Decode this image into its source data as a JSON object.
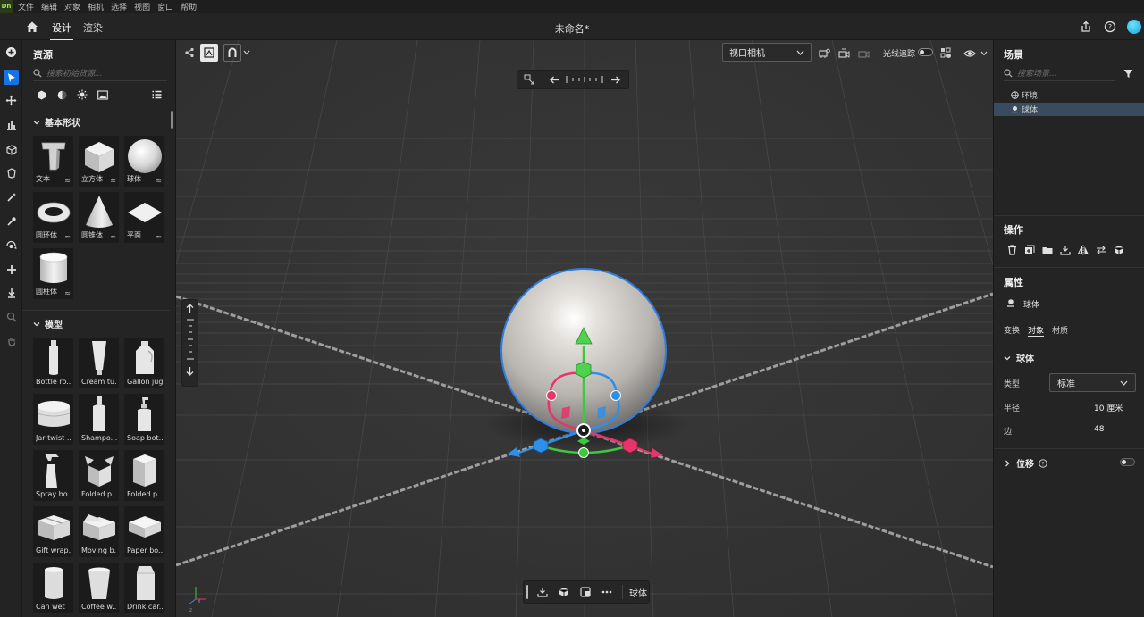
{
  "app": {
    "logo": "Dn",
    "document_title": "未命名*"
  },
  "menu": [
    "文件",
    "编辑",
    "对象",
    "相机",
    "选择",
    "视图",
    "窗口",
    "帮助"
  ],
  "mode_tabs": [
    {
      "label": "设计",
      "active": true
    },
    {
      "label": "渲染",
      "active": false
    }
  ],
  "assets_panel": {
    "title": "资源",
    "search_placeholder": "搜索初始货源...",
    "basic_shapes": {
      "title": "基本形状",
      "items": [
        {
          "label": "文本",
          "icon": "text-t-icon"
        },
        {
          "label": "立方体",
          "icon": "cube-icon"
        },
        {
          "label": "球体",
          "icon": "sphere-icon"
        },
        {
          "label": "圆环体",
          "icon": "torus-icon"
        },
        {
          "label": "圆锥体",
          "icon": "cone-icon"
        },
        {
          "label": "平面",
          "icon": "plane-icon"
        },
        {
          "label": "圆柱体",
          "icon": "cylinder-icon"
        }
      ]
    },
    "models": {
      "title": "模型",
      "items": [
        {
          "label": "Bottle ro...",
          "icon": "bottle-icon"
        },
        {
          "label": "Cream tu...",
          "icon": "tube-icon"
        },
        {
          "label": "Gallon jug",
          "icon": "jug-icon"
        },
        {
          "label": "Jar twist ...",
          "icon": "jar-icon"
        },
        {
          "label": "Shampo...",
          "icon": "shampoo-icon"
        },
        {
          "label": "Soap bot...",
          "icon": "soap-bottle-icon"
        },
        {
          "label": "Spray bo...",
          "icon": "spray-bottle-icon"
        },
        {
          "label": "Folded p...",
          "icon": "open-box-icon"
        },
        {
          "label": "Folded p...",
          "icon": "box-icon"
        },
        {
          "label": "Gift wrap...",
          "icon": "gift-box-icon"
        },
        {
          "label": "Moving b...",
          "icon": "moving-box-icon"
        },
        {
          "label": "Paper bo...",
          "icon": "paper-box-icon"
        },
        {
          "label": "Can wet",
          "icon": "can-icon"
        },
        {
          "label": "Coffee w...",
          "icon": "coffee-cup-icon"
        },
        {
          "label": "Drink car...",
          "icon": "carton-icon"
        }
      ]
    }
  },
  "viewport": {
    "camera_select": "视口相机",
    "light_tracing_label": "光线追踪",
    "light_tracing_on": false,
    "selected_object_label": "球体"
  },
  "scene_panel": {
    "title": "场景",
    "search_placeholder": "搜索场景...",
    "items": [
      {
        "label": "环境",
        "selected": false,
        "icon": "globe-icon"
      },
      {
        "label": "球体",
        "selected": true,
        "icon": "shape-icon"
      }
    ]
  },
  "actions_panel": {
    "title": "操作"
  },
  "properties_panel": {
    "title": "属性",
    "object_name": "球体",
    "tabs": [
      {
        "label": "变换",
        "active": false
      },
      {
        "label": "对象",
        "active": true
      },
      {
        "label": "材质",
        "active": false
      }
    ],
    "section_title": "球体",
    "type_label": "类型",
    "type_value": "标准",
    "radius_label": "半径",
    "radius_value": "10 厘米",
    "sides_label": "边",
    "sides_value": "48",
    "displacement_label": "位移",
    "displacement_on": false
  }
}
